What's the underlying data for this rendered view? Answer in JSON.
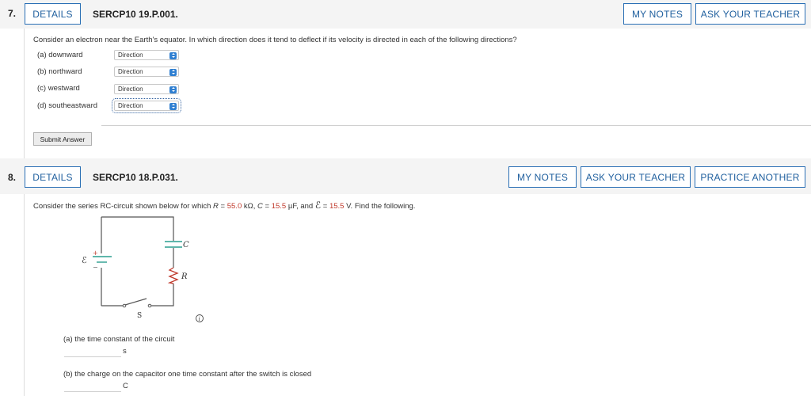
{
  "q7": {
    "number": "7.",
    "details": "DETAILS",
    "code": "SERCP10 19.P.001.",
    "my_notes": "MY NOTES",
    "ask_teacher": "ASK YOUR TEACHER",
    "prompt": "Consider an electron near the Earth's equator. In which direction does it tend to deflect if its velocity is directed in each of the following directions?",
    "parts": [
      {
        "label": "(a) downward",
        "value": "Direction"
      },
      {
        "label": "(b) northward",
        "value": "Direction"
      },
      {
        "label": "(c) westward",
        "value": "Direction"
      },
      {
        "label": "(d) southeastward",
        "value": "Direction"
      }
    ],
    "submit": "Submit Answer"
  },
  "q8": {
    "number": "8.",
    "details": "DETAILS",
    "code": "SERCP10 18.P.031.",
    "my_notes": "MY NOTES",
    "ask_teacher": "ASK YOUR TEACHER",
    "practice": "PRACTICE ANOTHER",
    "prompt_a": "Consider the series RC-circuit shown below for which ",
    "R_sym": "R",
    "eq": " = ",
    "R_val": "55.0",
    "R_unit": " kΩ, ",
    "C_sym": "C",
    "C_val": "15.5",
    "C_unit": " µF, and ",
    "E_sym": "ℰ",
    "E_val": "15.5",
    "E_unit": " V. Find the following.",
    "circuit": {
      "label_E": "ℰ",
      "label_C": "C",
      "label_R": "R",
      "label_S": "S",
      "plus": "+",
      "minus": "−",
      "info": "i"
    },
    "part_a": "(a) the time constant of the circuit",
    "unit_a": "s",
    "part_b": "(b) the charge on the capacitor one time constant after the switch is closed",
    "unit_b": "C"
  },
  "colors": {
    "accent": "#2a6fb5",
    "value_red": "#c0392b",
    "select_blue": "#2f7fd1"
  }
}
